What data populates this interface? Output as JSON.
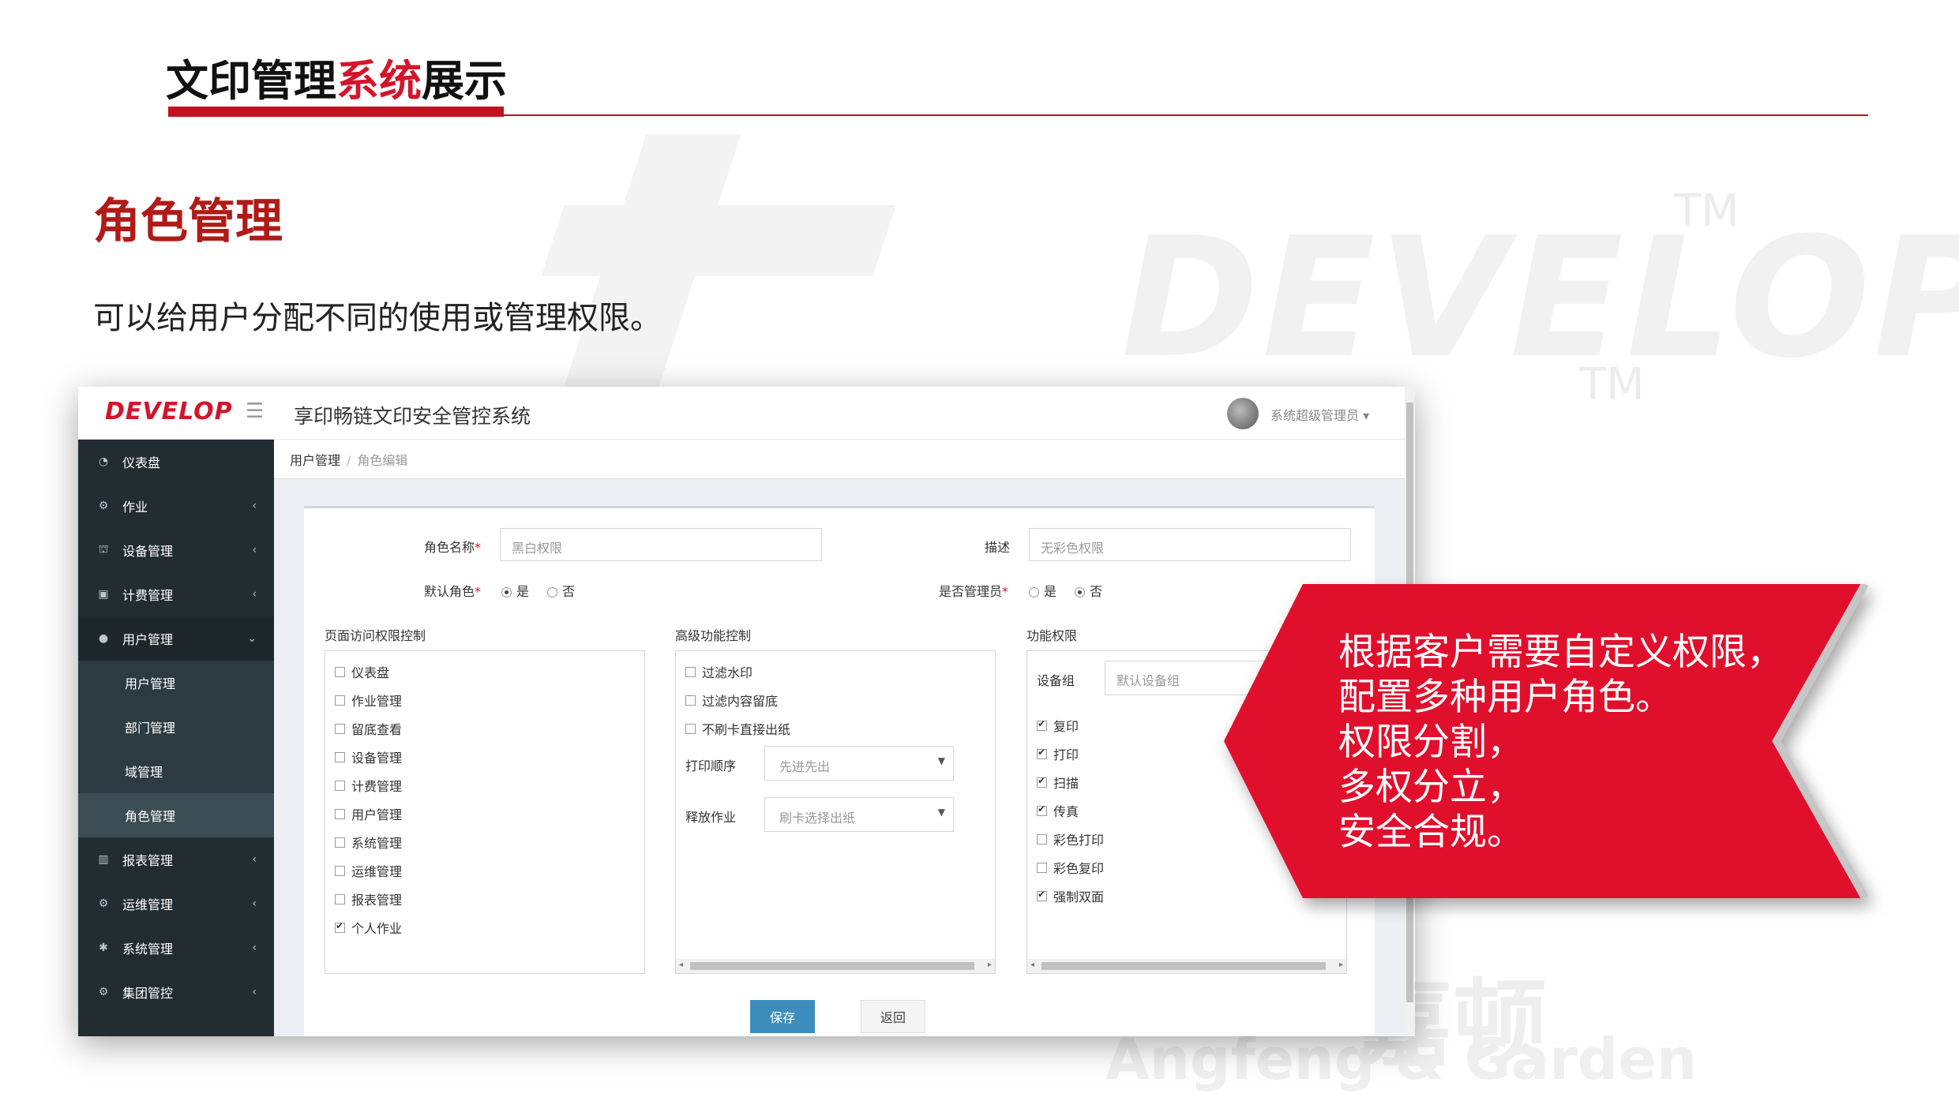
{
  "slide": {
    "title_part1": "文印管理",
    "title_part2": "系统",
    "title_part3": "展示",
    "section_title": "角色管理",
    "section_desc": "可以给用户分配不同的使用或管理权限。",
    "watermark_brand": "DEVELOP",
    "watermark_tm": "TM",
    "watermark_company_en": "Angfeng & Garden",
    "watermark_company_cn": "嘉顿"
  },
  "app": {
    "brand": "DEVELOP",
    "title": "享印畅链文印安全管控系统",
    "user": "系统超级管理员"
  },
  "sidebar": {
    "items": [
      {
        "label": "仪表盘",
        "icon": "dashboard-icon"
      },
      {
        "label": "作业",
        "icon": "gears-icon",
        "chevron": "‹"
      },
      {
        "label": "设备管理",
        "icon": "sitemap-icon",
        "chevron": "‹"
      },
      {
        "label": "计费管理",
        "icon": "money-icon",
        "chevron": "‹"
      },
      {
        "label": "用户管理",
        "icon": "user-icon",
        "chevron": "⌄"
      },
      {
        "label": "报表管理",
        "icon": "bar-chart-icon",
        "chevron": "‹"
      },
      {
        "label": "运维管理",
        "icon": "gears-icon",
        "chevron": "‹"
      },
      {
        "label": "系统管理",
        "icon": "gear-icon",
        "chevron": "‹"
      },
      {
        "label": "集团管控",
        "icon": "gears-icon",
        "chevron": "‹"
      }
    ],
    "sub_items": [
      "用户管理",
      "部门管理",
      "域管理",
      "角色管理"
    ]
  },
  "breadcrumb": {
    "parent": "用户管理",
    "current": "角色编辑"
  },
  "form": {
    "role_name_label": "角色名称",
    "role_name_value": "黑白权限",
    "desc_label": "描述",
    "desc_value": "无彩色权限",
    "default_role_label": "默认角色",
    "is_admin_label": "是否管理员",
    "yes": "是",
    "no": "否",
    "required_mark": "*"
  },
  "page_access": {
    "title": "页面访问权限控制",
    "items": [
      {
        "label": "仪表盘",
        "checked": false
      },
      {
        "label": "作业管理",
        "checked": false
      },
      {
        "label": "留底查看",
        "checked": false
      },
      {
        "label": "设备管理",
        "checked": false
      },
      {
        "label": "计费管理",
        "checked": false
      },
      {
        "label": "用户管理",
        "checked": false
      },
      {
        "label": "系统管理",
        "checked": false
      },
      {
        "label": "运维管理",
        "checked": false
      },
      {
        "label": "报表管理",
        "checked": false
      },
      {
        "label": "个人作业",
        "checked": true
      }
    ]
  },
  "advanced": {
    "title": "高级功能控制",
    "items": [
      {
        "label": "过滤水印",
        "checked": false
      },
      {
        "label": "过滤内容留底",
        "checked": false
      },
      {
        "label": "不刷卡直接出纸",
        "checked": false
      }
    ],
    "print_order_label": "打印顺序",
    "print_order_value": "先进先出",
    "release_label": "释放作业",
    "release_value": "刷卡选择出纸"
  },
  "functions": {
    "title": "功能权限",
    "device_group_label": "设备组",
    "device_group_value": "默认设备组",
    "items": [
      {
        "label": "复印",
        "checked": true
      },
      {
        "label": "打印",
        "checked": true
      },
      {
        "label": "扫描",
        "checked": true
      },
      {
        "label": "传真",
        "checked": true
      },
      {
        "label": "彩色打印",
        "checked": false
      },
      {
        "label": "彩色复印",
        "checked": false
      },
      {
        "label": "强制双面",
        "checked": true
      }
    ]
  },
  "buttons": {
    "save": "保存",
    "back": "返回"
  },
  "callout": {
    "lines": [
      "根据客户需要自定义权限，",
      "配置多种用户角色。",
      "权限分割，",
      "多权分立，",
      "安全合规。"
    ]
  },
  "colors": {
    "accent_red": "#d3152b",
    "sidebar_bg": "#222d32",
    "save_blue": "#3c8dbc"
  }
}
